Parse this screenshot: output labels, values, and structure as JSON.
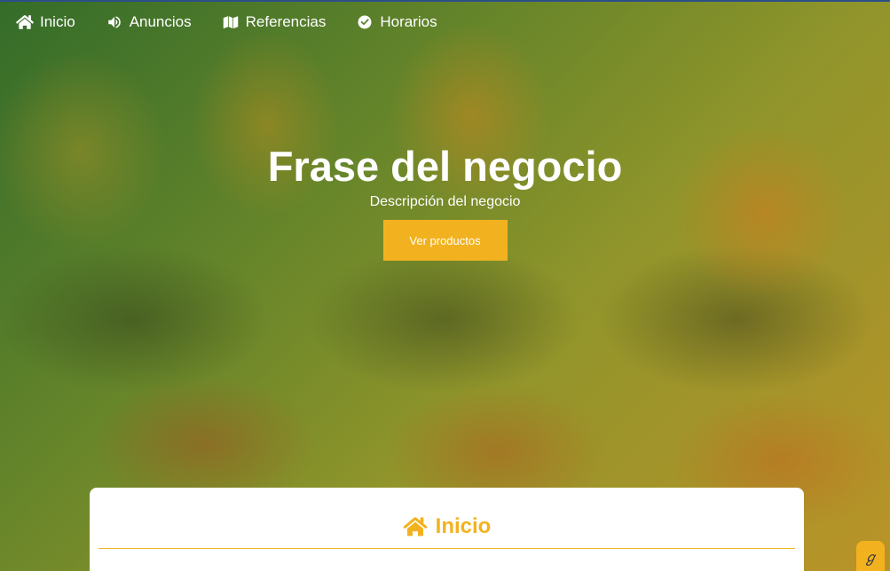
{
  "navbar": {
    "items": [
      {
        "label": "Inicio",
        "icon": "home-icon"
      },
      {
        "label": "Anuncios",
        "icon": "megaphone-icon"
      },
      {
        "label": "Referencias",
        "icon": "map-icon"
      },
      {
        "label": "Horarios",
        "icon": "check-circle-icon"
      }
    ]
  },
  "hero": {
    "title": "Frase del negocio",
    "description": "Descripción del negocio",
    "button_label": "Ver productos"
  },
  "section": {
    "title": "Inicio",
    "icon": "home-icon"
  },
  "colors": {
    "accent": "#f2b21f",
    "top_rule": "#2c4f8a",
    "card": "#ffffff"
  },
  "badge": {
    "icon": "chat-widget-icon"
  }
}
